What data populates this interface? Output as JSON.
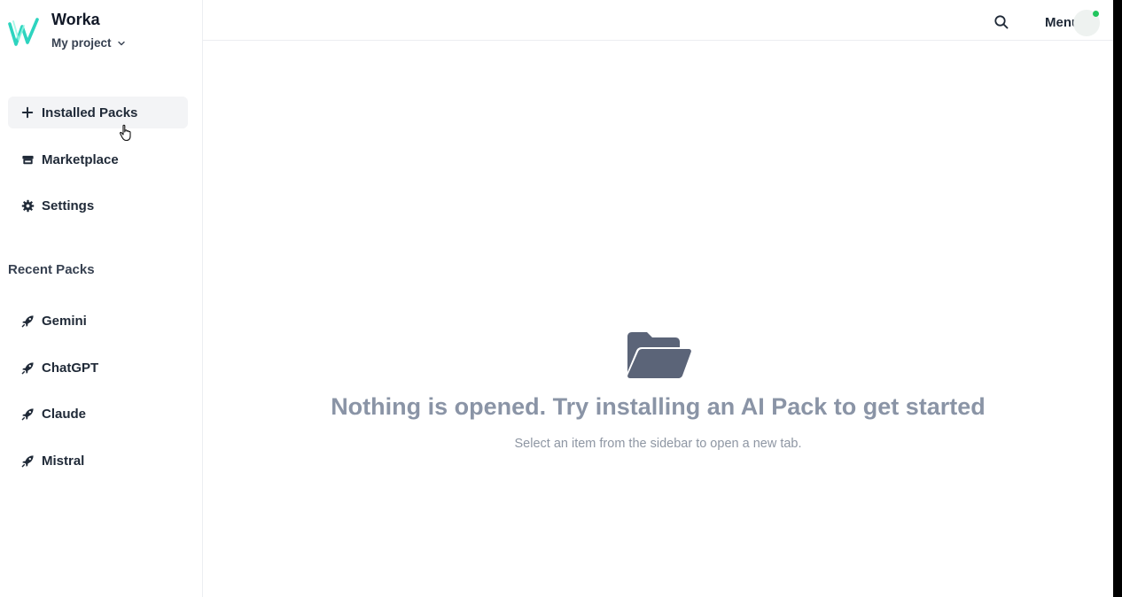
{
  "brand": {
    "name": "Worka",
    "project": "My project"
  },
  "nav": {
    "installed_packs": "Installed Packs",
    "marketplace": "Marketplace",
    "settings": "Settings"
  },
  "recent": {
    "title": "Recent Packs",
    "items": [
      {
        "label": "Gemini"
      },
      {
        "label": "ChatGPT"
      },
      {
        "label": "Claude"
      },
      {
        "label": "Mistral"
      }
    ]
  },
  "header": {
    "menu_label": "Menu"
  },
  "empty_state": {
    "title": "Nothing is opened. Try installing an AI Pack to get started",
    "subtitle": "Select an item from the sidebar to open a new tab."
  },
  "colors": {
    "logo_accent": "#2dd4bf",
    "status_online": "#22c55e",
    "empty_text": "#8a94a6",
    "folder_icon": "#5b6478"
  },
  "icons": {
    "installed_packs": "plus-icon",
    "marketplace": "store-icon",
    "settings": "gear-icon",
    "recent_pack": "rocket-icon",
    "search": "search-icon",
    "empty": "folder-open-icon"
  }
}
